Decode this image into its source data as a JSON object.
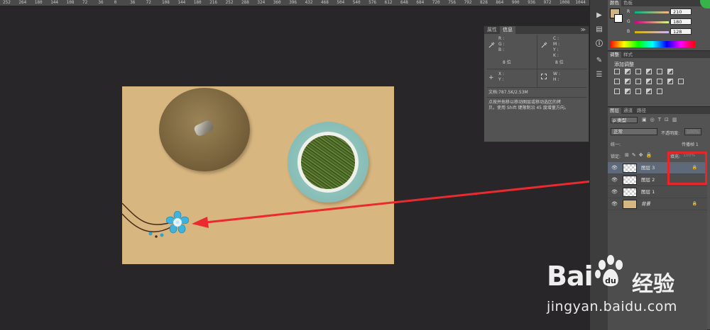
{
  "ruler": {
    "ticks": [
      "252",
      "264",
      "180",
      "144",
      "108",
      "72",
      "36",
      "0",
      "36",
      "72",
      "108",
      "144",
      "180",
      "216",
      "252",
      "288",
      "324",
      "360",
      "396",
      "432",
      "468",
      "504",
      "540",
      "576",
      "612",
      "648",
      "684",
      "720",
      "756",
      "792",
      "828",
      "864",
      "900",
      "936",
      "972",
      "1008",
      "1044"
    ]
  },
  "info_panel": {
    "tab_properties": "属性",
    "tab_info": "信息",
    "collapse": "≫",
    "r": "R :",
    "g": "G :",
    "b": "B :",
    "c": "C :",
    "m": "M :",
    "y": "Y :",
    "k": "K :",
    "bit_left": "8 位",
    "bit_right": "8 位",
    "x": "X :",
    "y2": "Y :",
    "w": "W :",
    "h": "H :",
    "doc_size": "文档:787.5K/2.53M",
    "hint_line1": "点按并拖移以移动图层或移动选区的拷",
    "hint_line2": "贝。使用 Shift 键限制沿 45 度增量方向。"
  },
  "color_panel": {
    "tab": "颜色",
    "tab2": "色板",
    "r_label": "R",
    "g_label": "G",
    "b_label": "B",
    "r_value": "210",
    "g_value": "180",
    "b_value": "128",
    "foreground": "#d2b480"
  },
  "adjust_panel": {
    "tab": "调整",
    "tab2": "样式",
    "title": "添加调整"
  },
  "layers_panel": {
    "tab_layers": "图层",
    "tab_channels": "通道",
    "tab_paths": "路径",
    "filter_kind": "ρ 类型",
    "blend_mode": "正常",
    "opacity_label": "不透明度:",
    "opacity_value": "100%",
    "unify_label": "统一:",
    "propagate_label": "传播帧 1",
    "lock_label": "锁定:",
    "fill_label": "填充:",
    "fill_value": "100%",
    "layers": [
      {
        "name": "图层 3",
        "selected": true,
        "locked": true
      },
      {
        "name": "图层 2",
        "selected": false,
        "locked": false
      },
      {
        "name": "图层 1",
        "selected": false,
        "locked": false
      },
      {
        "name": "背景",
        "selected": false,
        "locked": true
      }
    ]
  },
  "watermark": {
    "brand": "Bai",
    "brand_cn": "经验",
    "url": "jingyan.baidu.com"
  },
  "icons": [
    "eyedropper-icon",
    "move-icon",
    "selection-icon",
    "eye-icon",
    "lock-icon",
    "paw-icon",
    "play-icon",
    "info-icon"
  ]
}
